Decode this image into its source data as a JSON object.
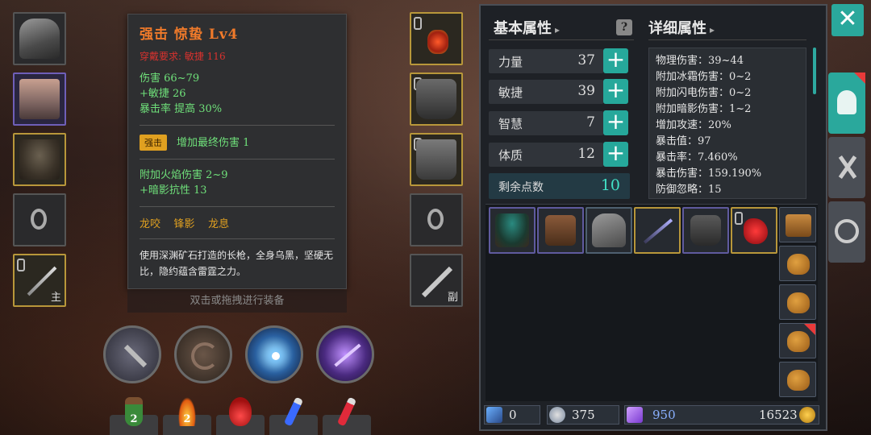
{
  "tooltip": {
    "title": "强击 惊蛰 Lv4",
    "requirement": "穿戴要求:   敏捷 116",
    "base_stats": [
      "伤害  66~79",
      "+敏捷 26",
      "暴击率 提高 30%"
    ],
    "badge": "强击",
    "badge_effect": "增加最终伤害 1",
    "extra_stats": [
      "附加火焰伤害 2~9",
      "+暗影抗性 13"
    ],
    "set_names": [
      "龙咬",
      "锋影",
      "龙息"
    ],
    "description": "使用深渊矿石打造的长枪，全身乌黑，坚硬无比，隐约蕴含雷霆之力。"
  },
  "hint": "双击或拖拽进行装备",
  "slot_tags": {
    "main": "主",
    "off": "副"
  },
  "potions": [
    {
      "name": "green-potion",
      "count": "2"
    },
    {
      "name": "campfire",
      "count": "2"
    },
    {
      "name": "red-flask",
      "count": ""
    },
    {
      "name": "blue-vial",
      "count": ""
    },
    {
      "name": "red-vial",
      "count": ""
    }
  ],
  "panel": {
    "basic_header": "基本属性",
    "detail_header": "详细属性",
    "stats": [
      {
        "label": "力量",
        "value": "37"
      },
      {
        "label": "敏捷",
        "value": "39"
      },
      {
        "label": "智慧",
        "value": "7"
      },
      {
        "label": "体质",
        "value": "12"
      }
    ],
    "remaining_label": "剩余点数",
    "remaining_value": "10",
    "details": [
      "物理伤害：39~44",
      "附加冰霜伤害：0~2",
      "附加闪电伤害：0~2",
      "附加暗影伤害：1~2",
      "增加攻速：20%",
      "暴击值：97",
      "暴击率：7.460%",
      "暴击伤害：159.190%",
      "防御忽略：15"
    ]
  },
  "currency": {
    "wand": "0",
    "shield": "375",
    "gem": "950",
    "gold": "16523"
  },
  "colors": {
    "accent": "#2aa89c",
    "orange_title": "#f07a2a",
    "green_stat": "#6fe07a",
    "red_req": "#d8322e",
    "gold_text": "#e0a020"
  }
}
